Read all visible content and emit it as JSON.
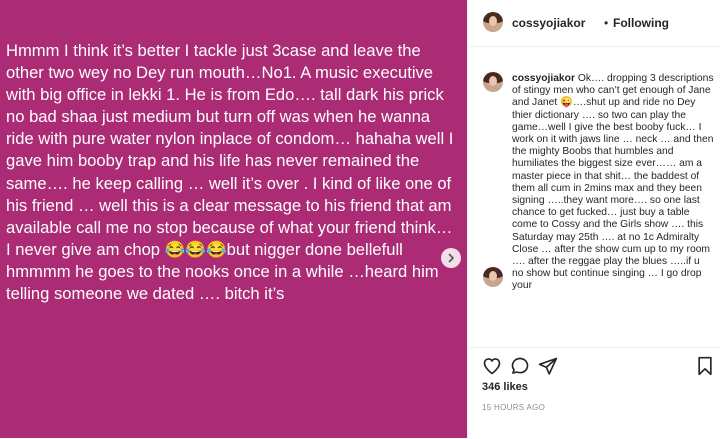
{
  "post": {
    "image_text": "Hmmm I think it’s better I tackle just 3case and leave the other two wey no Dey run mouth…No1. A music executive with big office in lekki 1. He is from Edo…. tall dark his prick no bad shaa just medium but turn off was when he wanna ride with pure water nylon inplace of condom… hahaha well I gave him booby trap and his life has never remained the same…. he keep calling … well it’s over . I kind of like one of his friend … well this is a clear message to his friend that am available call me no stop because of what your friend think… I never give am chop 😂😂😂but nigger done bellefull  hmmmm he goes to the nooks once in a while …heard him telling someone we dated …. bitch it’s",
    "background_color": "#ab2b75"
  },
  "header": {
    "username": "cossyojiakor",
    "separator": "•",
    "follow_status": "Following"
  },
  "caption": {
    "username": "cossyojiakor",
    "text": "Ok…. dropping 3 descriptions of stingy men who can’t get enough of Jane and Janet 😜….shut up and ride no Dey thier dictionary …. so two can play the game…well I give the best booby fuck… I work on it with jaws line … neck … and then the mighty Boobs that humbles and humiliates the biggest size ever…… am a master piece in that shit… the baddest of them all cum in 2mins max and they been signing …..they want more…. so one last chance to get fucked… just buy a table come to Cossy and the Girls show …. this Saturday may 25th …. at no 1c Admiralty Close … after the show cum up to my room …. after the reggae play the blues …..if u no show but continue singing … I go drop your"
  },
  "actions": {
    "icons": [
      "heart-icon",
      "comment-icon",
      "share-icon",
      "bookmark-icon"
    ],
    "likes": "346 likes",
    "timestamp": "15 HOURS AGO"
  }
}
